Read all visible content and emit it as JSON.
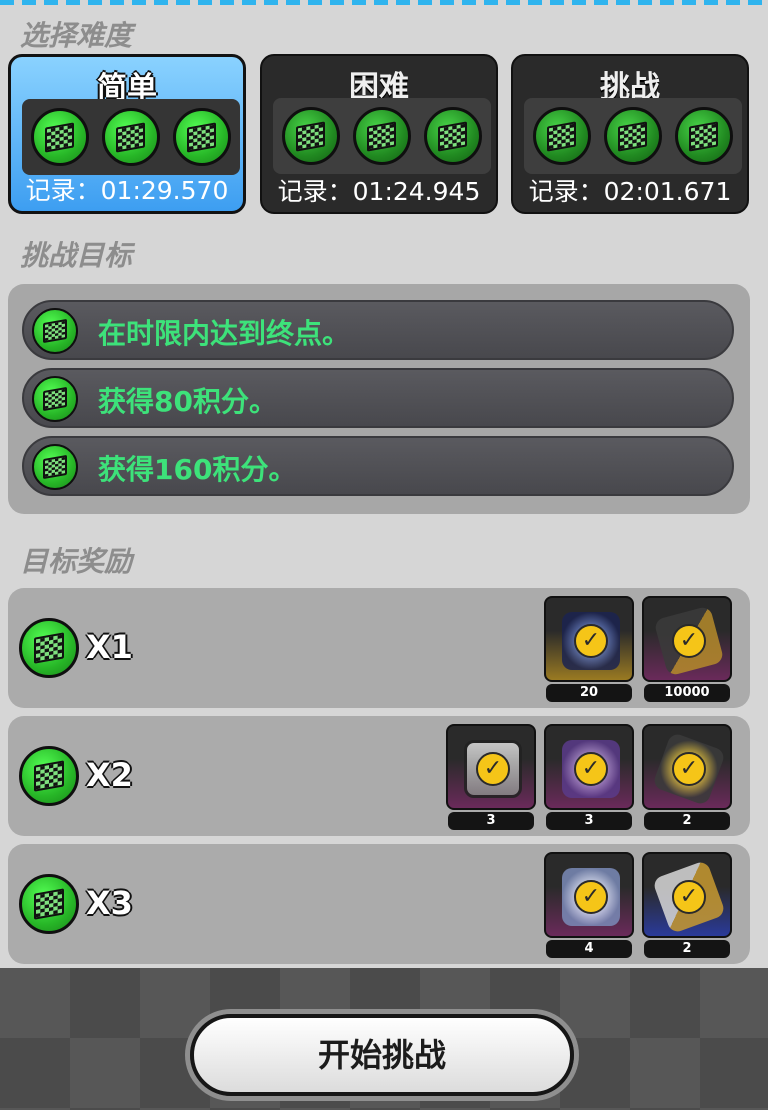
{
  "sections": {
    "difficulty_title": "选择难度",
    "objectives_title": "挑战目标",
    "rewards_title": "目标奖励"
  },
  "difficulties": [
    {
      "name": "简单",
      "record": "记录：01:29.570",
      "selected": true
    },
    {
      "name": "困难",
      "record": "记录：01:24.945",
      "selected": false
    },
    {
      "name": "挑战",
      "record": "记录：02:01.671",
      "selected": false
    }
  ],
  "objectives": [
    {
      "text": "在时限内达到终点。"
    },
    {
      "text": "获得80积分。"
    },
    {
      "text": "获得160积分。"
    }
  ],
  "rewards": [
    {
      "count": "X1",
      "items": [
        {
          "icon": "ring-token-icon",
          "qty": "20",
          "color": "gold"
        },
        {
          "icon": "card-voucher-icon",
          "qty": "10000",
          "color": "purple"
        }
      ]
    },
    {
      "count": "X2",
      "items": [
        {
          "icon": "document-cards-icon",
          "qty": "3",
          "color": "purple"
        },
        {
          "icon": "trophy-crystal-icon",
          "qty": "3",
          "color": "purple"
        },
        {
          "icon": "gold-chest-icon",
          "qty": "2",
          "color": "purple"
        }
      ]
    },
    {
      "count": "X3",
      "items": [
        {
          "icon": "crystal-cubes-icon",
          "qty": "4",
          "color": "purple"
        },
        {
          "icon": "paint-tube-icon",
          "qty": "2",
          "color": "blue"
        }
      ]
    }
  ],
  "start_button": "开始挑战",
  "colors": {
    "objective_text": "#3de27a",
    "selected_card": "#3d9ef1",
    "medal_green": "#27b627",
    "check_yellow": "#f5c518"
  }
}
